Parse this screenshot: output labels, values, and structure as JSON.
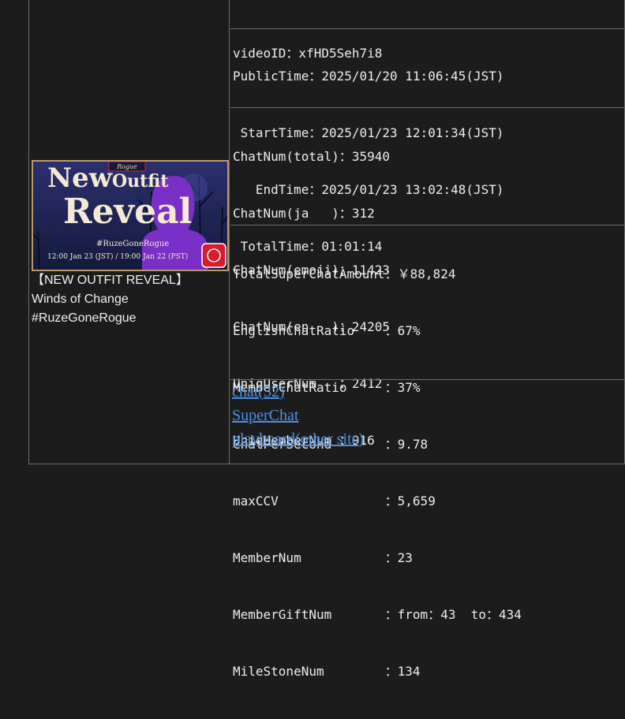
{
  "video": {
    "title_lines": [
      "【NEW OUTFIT REVEAL】",
      "Winds of Change",
      "#RuzeGoneRogue"
    ],
    "thumbnail": {
      "headline_1": "New",
      "headline_2": "Outfit",
      "headline_3": "Reveal",
      "hashtag": "#RuzeGoneRogue",
      "schedule": "12:00 Jan 23 (JST) / 19:00 Jan 22 (PST)"
    }
  },
  "info": {
    "video_id": "videoID：xfHD5Seh7i8",
    "times": [
      "PublicTime：2025/01/20 11:06:45(JST)",
      " StartTime：2025/01/23 12:01:34(JST)",
      "   EndTime：2025/01/23 13:02:48(JST)",
      " TotalTime：01:01:14"
    ],
    "chat": [
      "ChatNum(total)：35940",
      "ChatNum(ja   )：312",
      "ChatNum(emoji)：11423",
      "ChatNum(en   )：24205",
      "UniqUserNum   ：2412",
      "UniqMemberNum ：916"
    ],
    "stats": [
      "TotalSuperChatAmount：￥88,824",
      "EnglishChatRatio    ：67%",
      "MemberChatRatio     ：37%",
      "ChatPerSecond       ：9.78",
      "maxCCV              ：5,659",
      "MemberNum           ：23",
      "MemberGiftNum       ：from：43  to：434",
      "MileStoneNum        ：134"
    ]
  },
  "links": {
    "chat": "chat(32)",
    "superchat": "SuperChat",
    "playboard": "playboard(other site)"
  },
  "colors": {
    "background": "#1c1c1c",
    "border": "#6e6e6e",
    "link": "#4d90e6",
    "thumb_purple": "#7a2fc6"
  }
}
